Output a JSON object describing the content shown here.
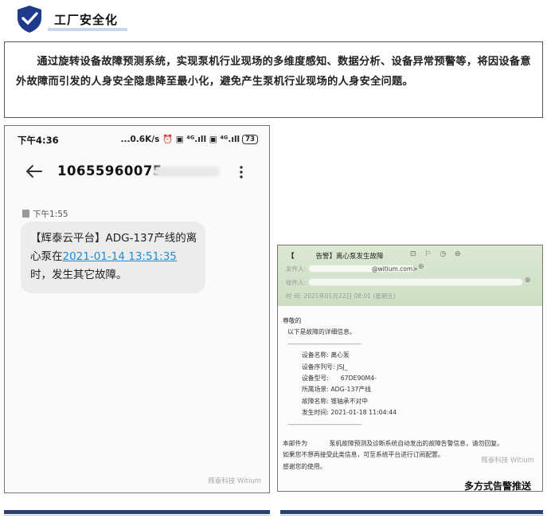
{
  "header": {
    "title": "工厂安全化",
    "icon": "shield-check-icon",
    "accent_color": "#1f3a8a"
  },
  "intro": {
    "text": "通过旋转设备故障预测系统，实现泵机行业现场的多维度感知、数据分析、设备异常预警等，将因设备意外故障而引发的人身安全隐患降至最小化，避免产生泵机行业现场的人身安全问题。"
  },
  "phone": {
    "status_time": "下午4:36",
    "status_right": "...0.6K/s ⏰ ▣ ⁴ᴳ.ıll ▣ ⁴ᴳ.ıll",
    "battery": "73",
    "sender": "10655960075",
    "message_time": "下午1:55",
    "message": {
      "part1": "【辉泰云平台】ADG-137产线的离心泵在",
      "link": "2021-01-14 13:51:35",
      "part2": "时，发生其它故障。"
    },
    "watermark": "辉泰科技 Witium"
  },
  "email": {
    "subject_bracket": "【",
    "subject": "告警】离心泵发生故障",
    "header_icons": "⊡ ⚐ ◷ ⊚",
    "from_label": "发件人:",
    "from_value": "@witium.com>",
    "to_label": "收件人:",
    "date_label": "时  间:",
    "date_value": "2021年01月22日 08:01 (星期五)",
    "greeting": "尊敬的",
    "intro": "以下是故障的详细信息。",
    "separator": "----------------------------------------",
    "fields": [
      {
        "label": "设备名称:",
        "value": "离心泵"
      },
      {
        "label": "设备序列号:",
        "value": "JSJ_"
      },
      {
        "label": "设备型号:",
        "value": "67DE90M4-"
      },
      {
        "label": "所属场景:",
        "value": "ADG-137产线"
      },
      {
        "label": "故障名称:",
        "value": "锥轴承不对中"
      },
      {
        "label": "发生时间:",
        "value": "2021-01-18 11:04:44"
      }
    ],
    "footer1_prefix": "本邮件为",
    "footer1_suffix": "泵机故障预测及诊断系统自动发出的故障告警信息，请勿回复。",
    "footer2": "如果您不想再接受此类信息，可至系统平台进行订阅配置。",
    "footer3": "感谢您的使用。",
    "watermark": "辉泰科技 Witium"
  },
  "caption": "多方式告警推送"
}
